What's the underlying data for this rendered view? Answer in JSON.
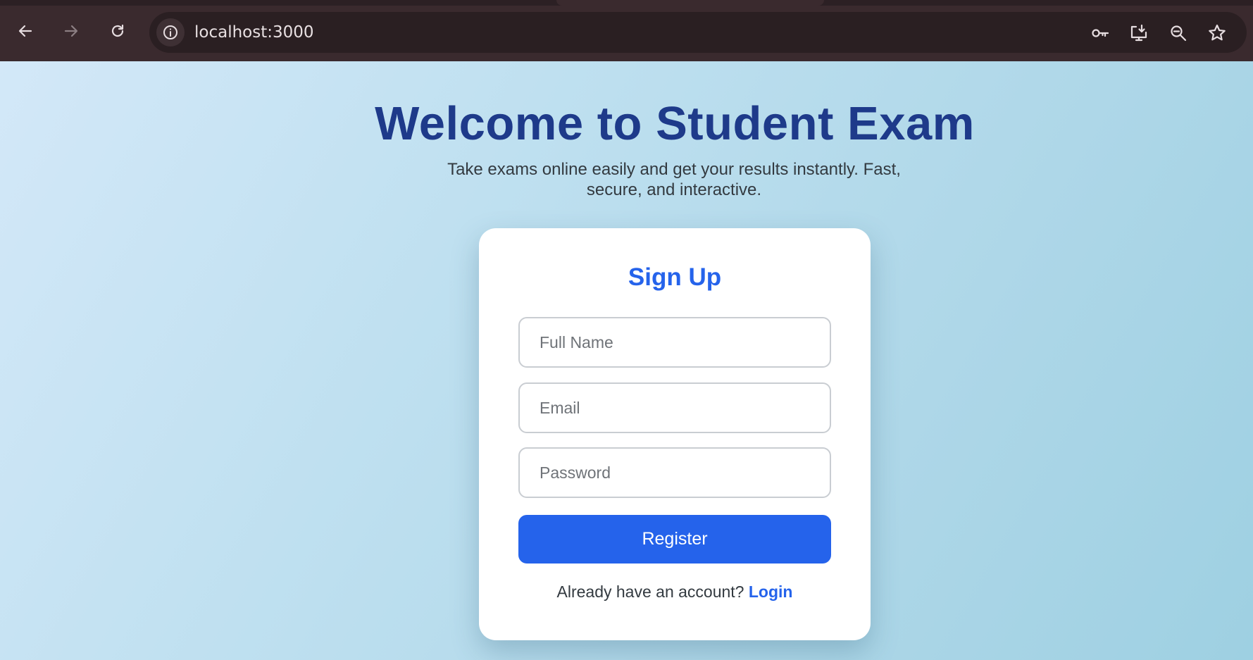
{
  "browser": {
    "url": "localhost:3000",
    "icons": {
      "back": "arrow-left-icon",
      "forward": "arrow-right-icon",
      "reload": "reload-icon",
      "site_info": "info-icon",
      "passwords": "key-icon",
      "install": "install-app-icon",
      "zoom": "zoom-icon",
      "bookmark": "star-icon"
    }
  },
  "hero": {
    "title": "Welcome to Student Exam",
    "subtitle": "Take exams online easily and get your results instantly. Fast, secure, and interactive."
  },
  "signup": {
    "title": "Sign Up",
    "full_name_placeholder": "Full Name",
    "email_placeholder": "Email",
    "password_placeholder": "Password",
    "register_label": "Register",
    "login_prompt": "Already have an account?",
    "login_link": "Login"
  },
  "colors": {
    "heading": "#1e3a8a",
    "accent": "#2563eb",
    "chrome": "#3a2a2e"
  }
}
